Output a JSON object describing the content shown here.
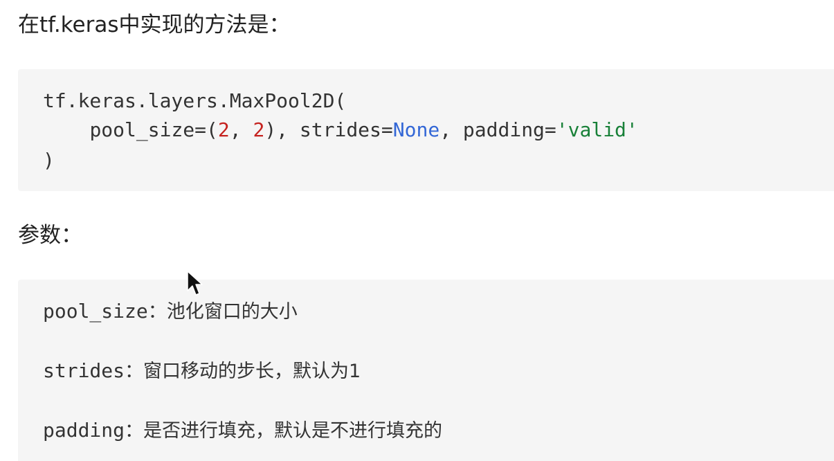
{
  "intro": "在tf.keras中实现的方法是：",
  "code": {
    "line1": "tf.keras.layers.MaxPool2D(",
    "line2_indent": "    ",
    "line2_pool_key": "pool_size=(",
    "line2_pool_n1": "2",
    "line2_pool_comma": ", ",
    "line2_pool_n2": "2",
    "line2_after_pool": "), strides=",
    "line2_none": "None",
    "line2_after_none": ", padding=",
    "line2_valid": "'valid'",
    "line3": ")"
  },
  "params_heading": "参数：",
  "params": [
    {
      "name": "pool_size",
      "sep": "：",
      "desc": "池化窗口的大小"
    },
    {
      "name": "strides",
      "sep": "：",
      "desc": "窗口移动的步长，默认为1"
    },
    {
      "name": "padding",
      "sep": "：",
      "desc": "是否进行填充，默认是不进行填充的"
    }
  ],
  "colors": {
    "code_background": "#f5f5f5",
    "number": "#c5221f",
    "keyword": "#3367d6",
    "string": "#188038"
  },
  "icons": {
    "cursor": "mouse-pointer-icon"
  }
}
